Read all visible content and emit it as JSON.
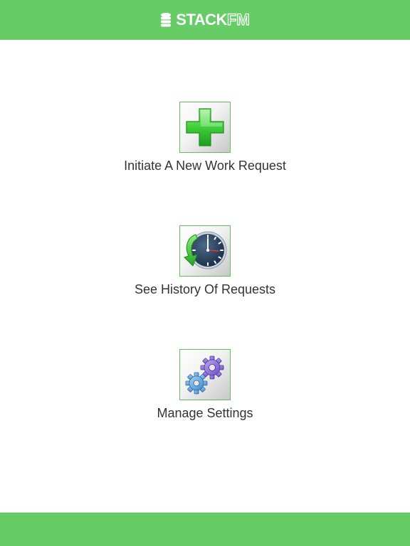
{
  "header": {
    "logo_strong": "STACK",
    "logo_outline": "FM",
    "logo_icon": "stacked-coins-icon",
    "background": "#66cc66"
  },
  "menu": {
    "items": [
      {
        "label": "Initiate A New Work Request",
        "icon": "plus-icon"
      },
      {
        "label": "See History Of Requests",
        "icon": "clock-history-icon"
      },
      {
        "label": "Manage Settings",
        "icon": "gears-icon"
      }
    ]
  },
  "colors": {
    "accent": "#66cc66",
    "label_text": "#333333"
  }
}
